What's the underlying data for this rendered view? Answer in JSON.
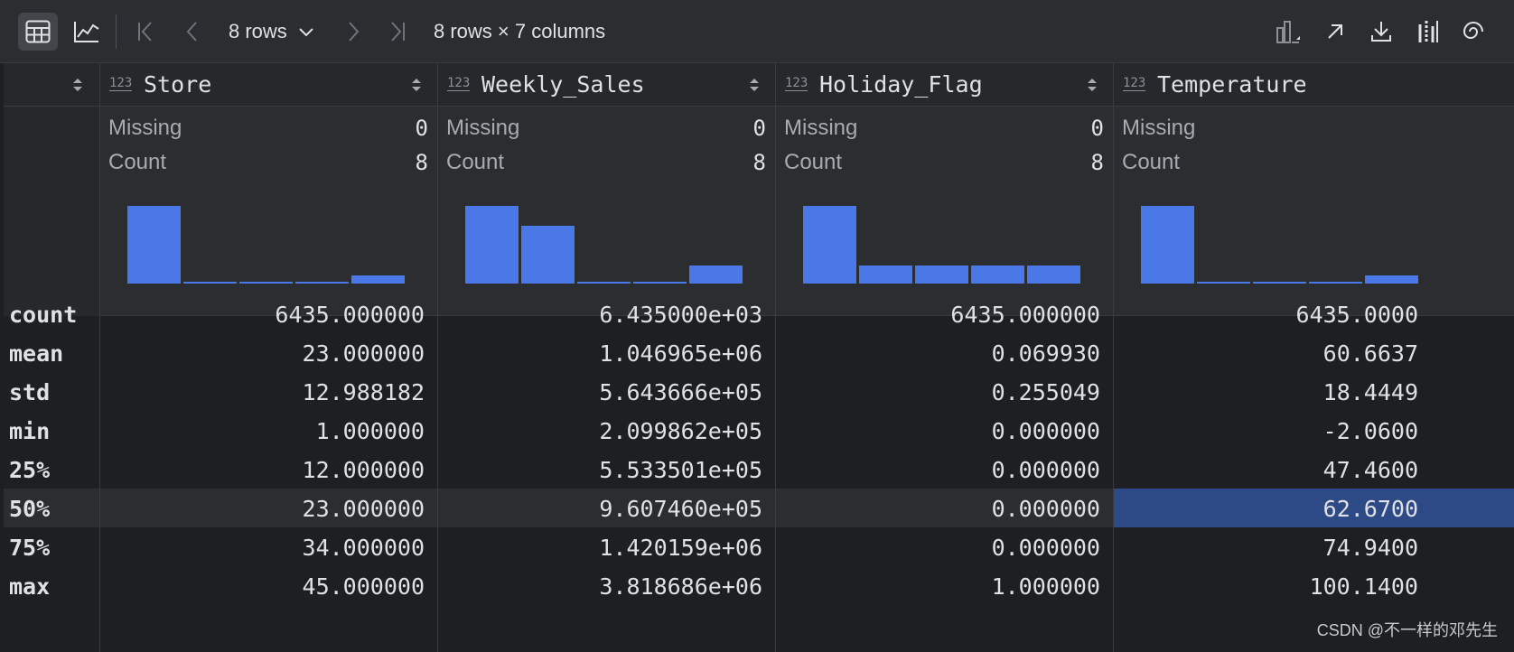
{
  "toolbar": {
    "rows_selector": "8 rows",
    "shape": "8 rows × 7 columns"
  },
  "columns": [
    {
      "type_badge": "123",
      "name": "Store",
      "missing_label": "Missing",
      "missing": "0",
      "count_label": "Count",
      "count": "8",
      "hist": [
        1.0,
        0.02,
        0.02,
        0.02,
        0.11
      ]
    },
    {
      "type_badge": "123",
      "name": "Weekly_Sales",
      "missing_label": "Missing",
      "missing": "0",
      "count_label": "Count",
      "count": "8",
      "hist": [
        1.0,
        0.74,
        0.02,
        0.02,
        0.23
      ]
    },
    {
      "type_badge": "123",
      "name": "Holiday_Flag",
      "missing_label": "Missing",
      "missing": "0",
      "count_label": "Count",
      "count": "8",
      "hist": [
        1.0,
        0.23,
        0.23,
        0.23,
        0.23
      ]
    },
    {
      "type_badge": "123",
      "name": "Temperature",
      "missing_label": "Missing",
      "missing": "",
      "count_label": "Count",
      "count": "",
      "hist": [
        1.0,
        0.02,
        0.02,
        0.02,
        0.11
      ]
    }
  ],
  "rows": [
    {
      "index": "count",
      "values": [
        "6435.000000",
        "6.435000e+03",
        "6435.000000",
        "6435.0000"
      ]
    },
    {
      "index": "mean",
      "values": [
        "23.000000",
        "1.046965e+06",
        "0.069930",
        "60.6637"
      ]
    },
    {
      "index": "std",
      "values": [
        "12.988182",
        "5.643666e+05",
        "0.255049",
        "18.4449"
      ]
    },
    {
      "index": "min",
      "values": [
        "1.000000",
        "2.099862e+05",
        "0.000000",
        "-2.0600"
      ]
    },
    {
      "index": "25%",
      "values": [
        "12.000000",
        "5.533501e+05",
        "0.000000",
        "47.4600"
      ]
    },
    {
      "index": "50%",
      "values": [
        "23.000000",
        "9.607460e+05",
        "0.000000",
        "62.6700"
      ]
    },
    {
      "index": "75%",
      "values": [
        "34.000000",
        "1.420159e+06",
        "0.000000",
        "74.9400"
      ]
    },
    {
      "index": "max",
      "values": [
        "45.000000",
        "3.818686e+06",
        "1.000000",
        "100.1400"
      ]
    }
  ],
  "highlight_row": 5,
  "selected_cell": {
    "row": 5,
    "col": 3
  },
  "watermark": "CSDN @不一样的邓先生",
  "colors": {
    "accent": "#4a78e6",
    "selection": "#2e4a86",
    "background": "#1e1f22"
  }
}
